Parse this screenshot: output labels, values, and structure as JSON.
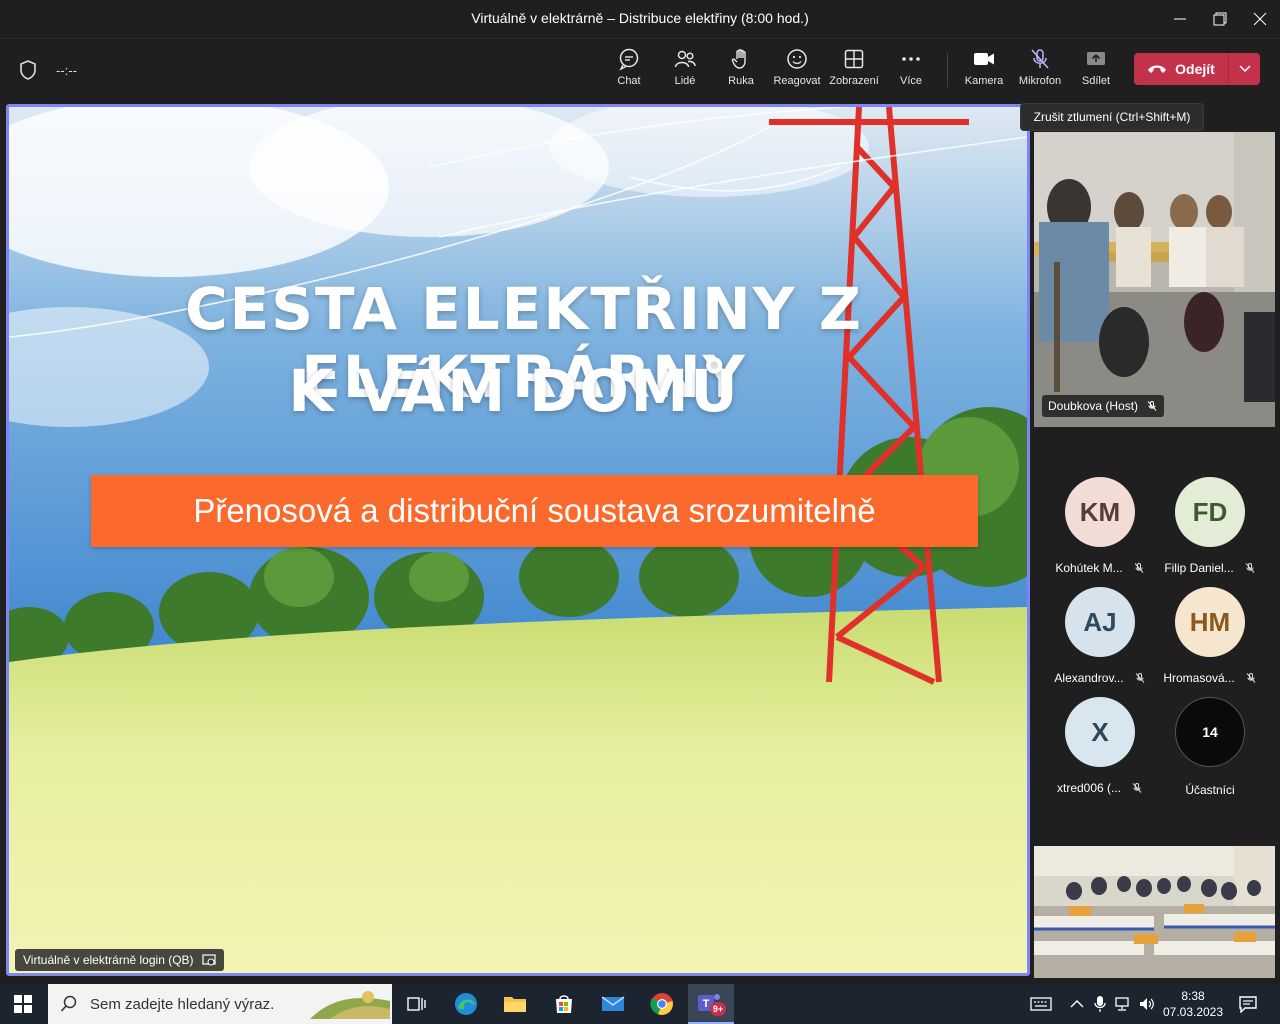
{
  "window": {
    "title": "Virtuálně v elektrárně – Distribuce elektřiny (8:00 hod.)"
  },
  "toolbar": {
    "timer": "--:--",
    "buttons": [
      {
        "label": "Chat",
        "icon": "chat-icon"
      },
      {
        "label": "Lidé",
        "icon": "people-icon"
      },
      {
        "label": "Ruka",
        "icon": "hand-icon"
      },
      {
        "label": "Reagovat",
        "icon": "smile-icon"
      },
      {
        "label": "Zobrazení",
        "icon": "grid-icon"
      },
      {
        "label": "Více",
        "icon": "more-icon"
      },
      {
        "label": "Kamera",
        "icon": "camera-icon"
      },
      {
        "label": "Mikrofon",
        "icon": "mic-off-icon"
      },
      {
        "label": "Sdílet",
        "icon": "share-icon"
      }
    ],
    "leave_label": "Odejít"
  },
  "tooltip": "Zrušit ztlumení (Ctrl+Shift+M)",
  "stage": {
    "slide_title_line1": "CESTA ELEKTŘINY Z ELEKTRÁRNY",
    "slide_title_line2": "K VÁM DOMŮ",
    "slide_banner": "Přenosová a distribuční soustava srozumitelně",
    "presenter_label": "Virtuálně v elektrárně login (QB)"
  },
  "video": {
    "name": "Doubkova (Host)"
  },
  "participants": [
    {
      "initials": "KM",
      "name": "Kohútek M...",
      "bg": "#f1dcd6",
      "fg": "#5b3b35"
    },
    {
      "initials": "FD",
      "name": "Filip Daniel...",
      "bg": "#e2ecd6",
      "fg": "#3d5a2e"
    },
    {
      "initials": "AJ",
      "name": "Alexandrov...",
      "bg": "#d6e3ec",
      "fg": "#2e4a5e"
    },
    {
      "initials": "HM",
      "name": "Hromasová...",
      "bg": "#f7e6cf",
      "fg": "#8a5a1c"
    },
    {
      "initials": "X",
      "name": "xtred006 (...",
      "bg": "#d8e6ef",
      "fg": "#2d4758"
    }
  ],
  "participants_count": {
    "count": "14",
    "label": "Účastníci"
  },
  "taskbar": {
    "search_placeholder": "Sem zadejte hledaný výraz.",
    "teams_badge": "9+",
    "time": "8:38",
    "date": "07.03.2023"
  },
  "colors": {
    "accent": "#7f85f5",
    "leave": "#c4314b",
    "banner": "#fb6a2c"
  }
}
